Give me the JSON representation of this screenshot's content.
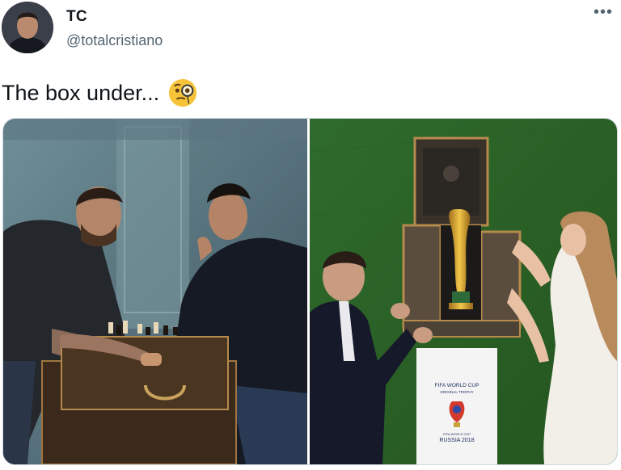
{
  "tweet": {
    "display_name": "TC",
    "handle": "@totalcristiano",
    "text": "The box under...",
    "emoji": "face-with-monocle",
    "more_icon": "more-icon"
  },
  "media": {
    "left_photo": {
      "subject": "two players at chess table on trunk"
    },
    "right_photo": {
      "subject": "trophy presented in trunk on pedestal",
      "pedestal_lines": [
        "FIFA WORLD CUP",
        "ORIGINAL TROPHY",
        "FIFA WORLD CUP",
        "RUSSIA 2018"
      ]
    }
  }
}
